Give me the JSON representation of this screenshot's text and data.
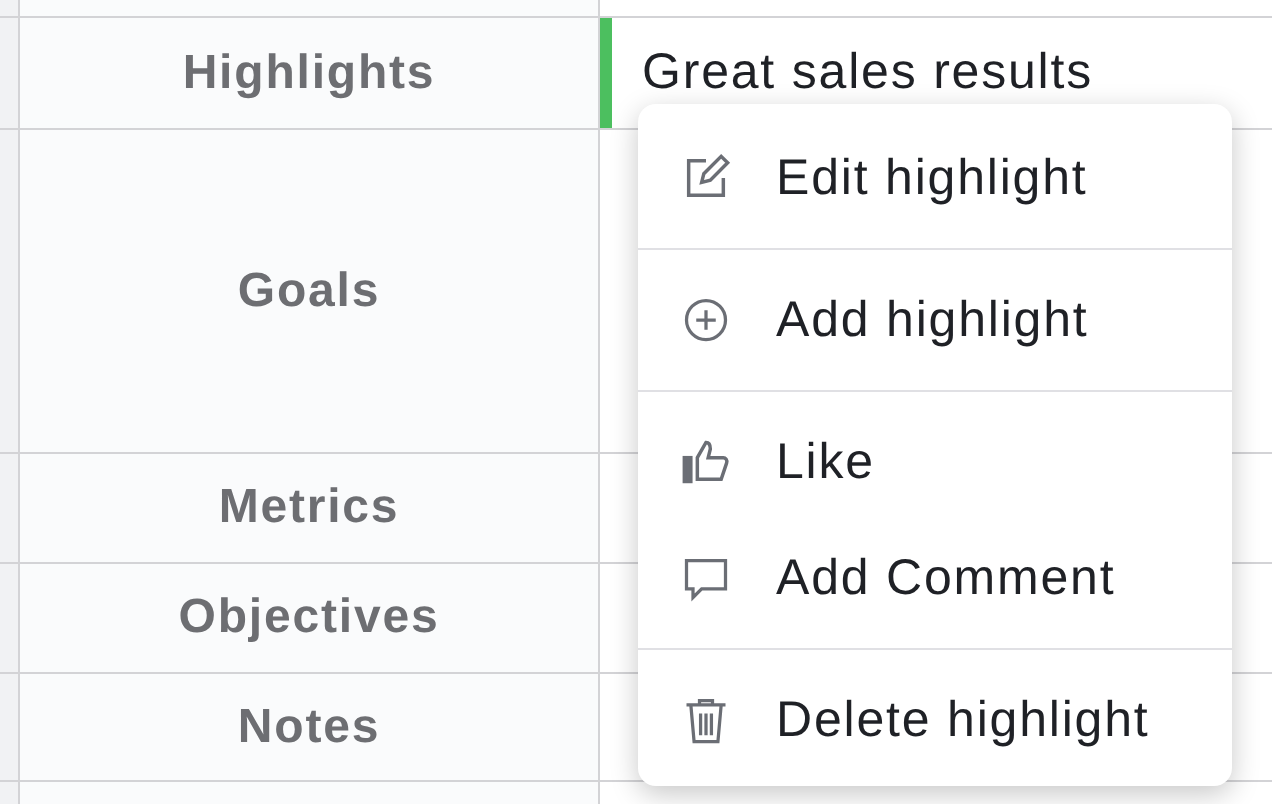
{
  "rows": [
    {
      "label": "Highlights",
      "highlight": {
        "text": "Great sales results",
        "color": "#4cbf5f"
      }
    },
    {
      "label": "Goals"
    },
    {
      "label": "Metrics"
    },
    {
      "label": "Objectives"
    },
    {
      "label": "Notes"
    }
  ],
  "menu": {
    "groups": [
      [
        {
          "kind": "edit",
          "label": "Edit highlight"
        }
      ],
      [
        {
          "kind": "add",
          "label": "Add highlight"
        }
      ],
      [
        {
          "kind": "like",
          "label": "Like"
        },
        {
          "kind": "comment",
          "label": "Add Comment"
        }
      ],
      [
        {
          "kind": "delete",
          "label": "Delete highlight"
        }
      ]
    ]
  }
}
